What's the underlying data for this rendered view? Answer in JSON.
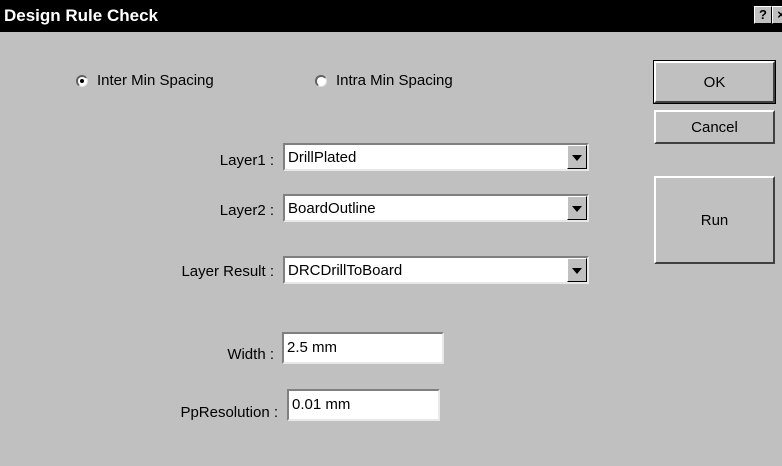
{
  "window": {
    "title": "Design Rule Check",
    "help_label": "?",
    "close_label": "×"
  },
  "spacing_mode": {
    "options": [
      {
        "label": "Inter Min Spacing",
        "checked": true
      },
      {
        "label": "Intra Min Spacing",
        "checked": false
      }
    ]
  },
  "fields": {
    "layer1": {
      "label": "Layer1 :",
      "value": "DrillPlated"
    },
    "layer2": {
      "label": "Layer2 :",
      "value": "BoardOutline"
    },
    "layer_result": {
      "label": "Layer Result :",
      "value": "DRCDrillToBoard"
    },
    "width": {
      "label": "Width :",
      "value": "2.5 mm"
    },
    "pp_resolution": {
      "label": "PpResolution :",
      "value": "0.01 mm"
    }
  },
  "buttons": {
    "ok": "OK",
    "cancel": "Cancel",
    "run": "Run"
  }
}
